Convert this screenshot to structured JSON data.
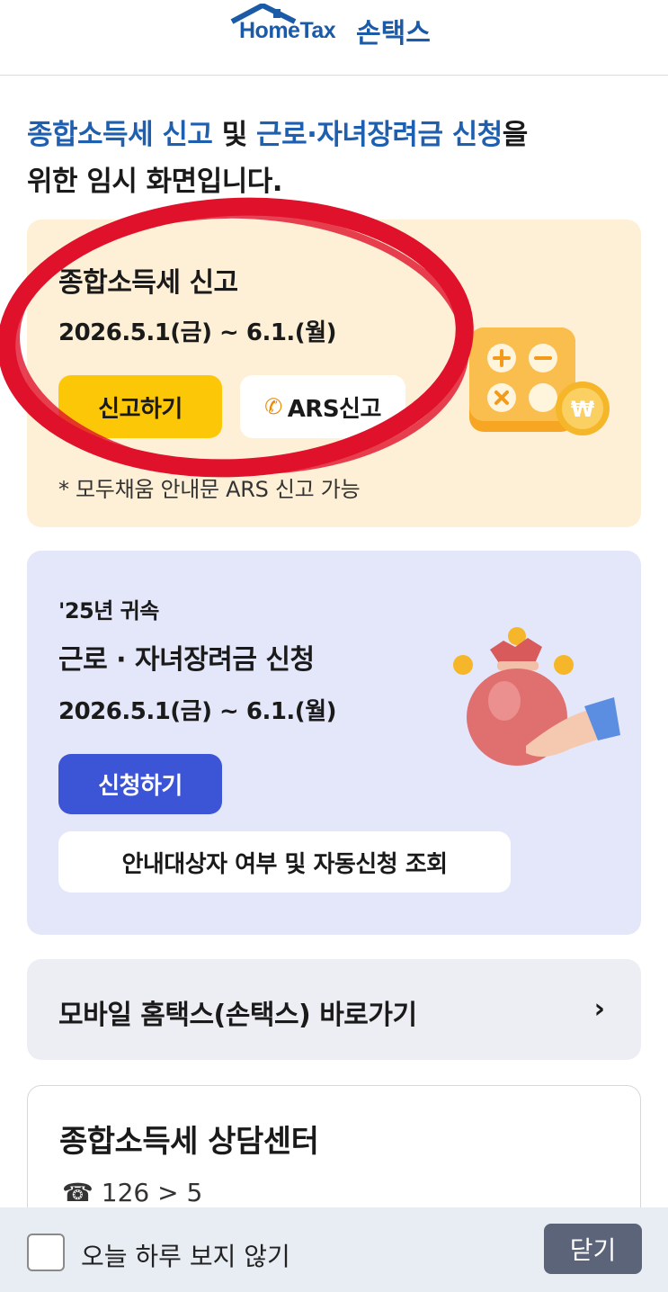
{
  "header": {
    "logo_en": "HomeTax",
    "logo_ko": "손택스",
    "brand_color": "#1b5aa6"
  },
  "intro": {
    "part1": "종합소득세 신고",
    "part2": " 및 ",
    "part3": "근로·자녀장려금 신청",
    "part4": "을",
    "part5": "위한 임시 화면입니다."
  },
  "tax_card": {
    "title": "종합소득세 신고",
    "date": "2026.5.1(금) ~ 6.1.(월)",
    "report_button": "신고하기",
    "ars_icon": "phone-icon",
    "ars_button": "ARS신고",
    "note": "* 모두채움 안내문 ARS 신고 가능",
    "illustration": "calculator-icon"
  },
  "child_card": {
    "subtitle": "'25년 귀속",
    "title": "근로 · 자녀장려금 신청",
    "date": "2026.5.1(금) ~ 6.1.(월)",
    "apply_button": "신청하기",
    "check_button": "안내대상자 여부 및 자동신청 조회",
    "illustration": "money-bag-icon"
  },
  "shortcut": {
    "label": "모바일 홈택스(손택스) 바로가기",
    "chevron": "›"
  },
  "consult": {
    "title": "종합소득세 상담센터",
    "phone_icon": "☎",
    "phone": "126 > 5"
  },
  "bottom_bar": {
    "no_show_label": "오늘 하루 보지 않기",
    "close_label": "닫기"
  }
}
